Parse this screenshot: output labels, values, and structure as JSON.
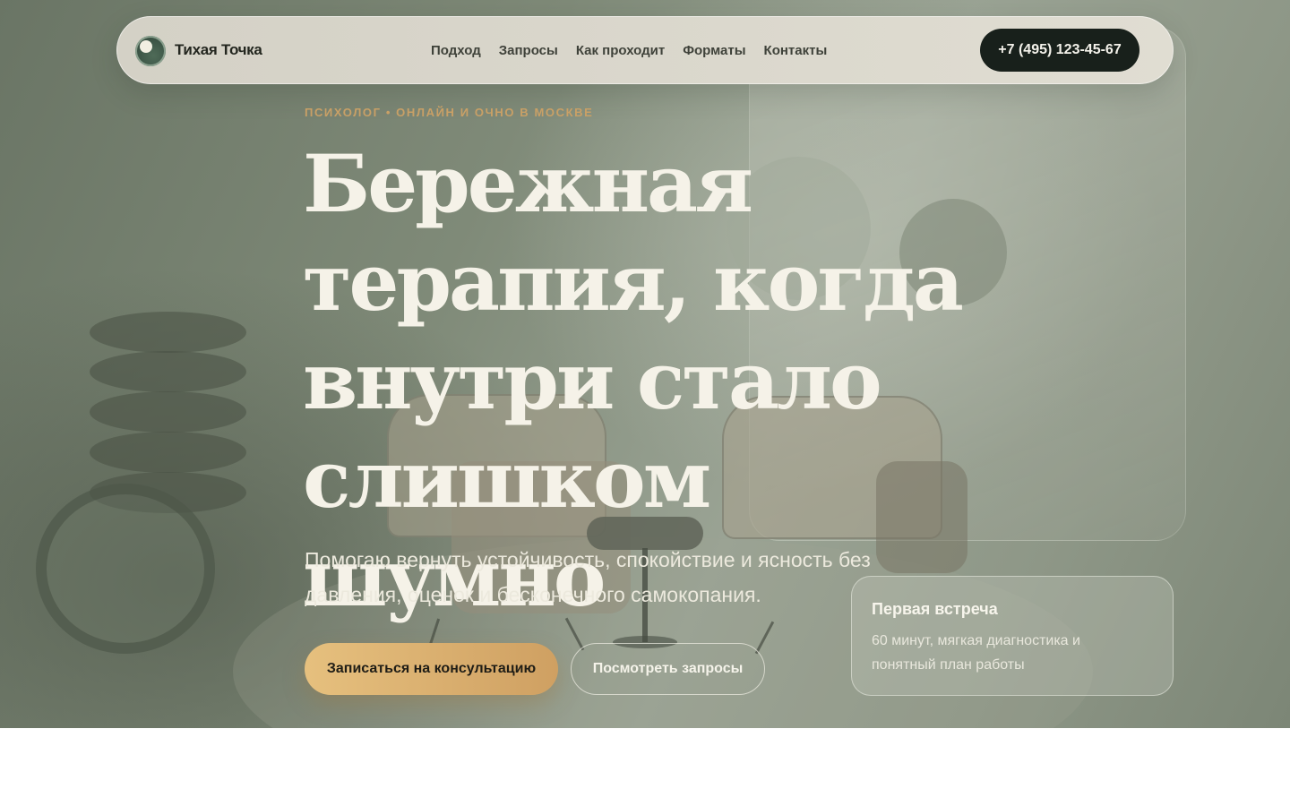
{
  "nav": {
    "brand": "Тихая Точка",
    "links": [
      "Подход",
      "Запросы",
      "Как проходит",
      "Форматы",
      "Контакты"
    ],
    "phone": "+7 (495) 123-45-67"
  },
  "hero": {
    "eyebrow": "ПСИХОЛОГ • ОНЛАЙН И ОЧНО В МОСКВЕ",
    "headline_lines": [
      "Бережная",
      "терапия, когда",
      "внутри стало",
      "слишком шумно"
    ],
    "subtitle": "Помогаю вернуть устойчивость, спокойствие и ясность без давления, оценок и бесконечного самокопания.",
    "primary_cta": "Записаться на консультацию",
    "secondary_cta": "Посмотреть запросы"
  },
  "card": {
    "title": "Первая встреча",
    "text": "60 минут, мягкая диагностика и понятный план работы"
  },
  "colors": {
    "accent_gold": "#cfa062",
    "dark_button": "#18201b",
    "headline": "#f5f2e8"
  }
}
